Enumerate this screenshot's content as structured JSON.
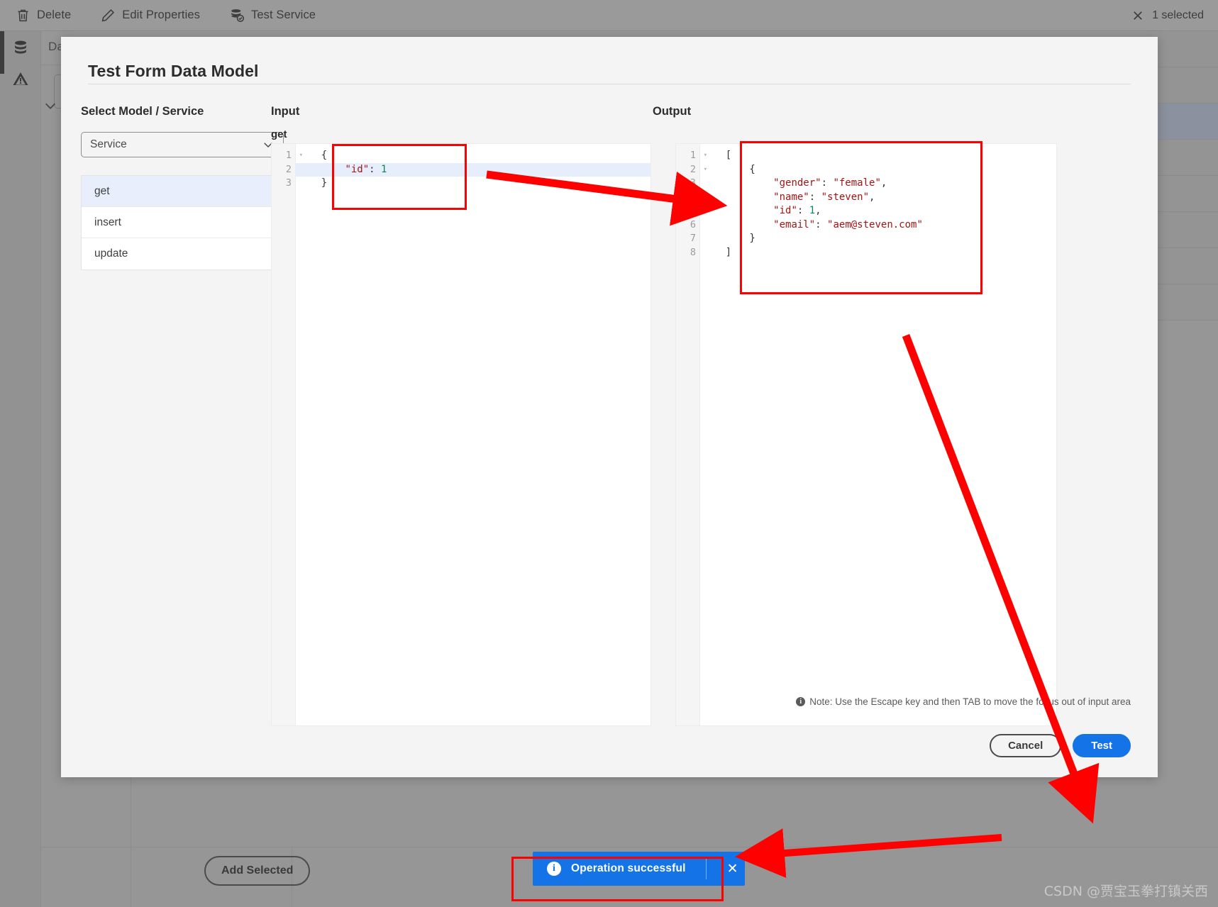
{
  "toolbar": {
    "items": [
      {
        "label": "Delete",
        "icon": "trash-icon"
      },
      {
        "label": "Edit Properties",
        "icon": "pencil-icon"
      },
      {
        "label": "Test Service",
        "icon": "database-check-icon"
      }
    ],
    "selection_label": "1 selected",
    "close_icon": "close-icon"
  },
  "background": {
    "breadcrumb": "Da",
    "add_selected_label": "Add Selected",
    "rail_icons": [
      "database-icon",
      "warning-icon"
    ]
  },
  "dialog": {
    "title": "Test Form Data Model",
    "left": {
      "label": "Select Model / Service",
      "select": {
        "value": "Service",
        "placeholder": "Service",
        "chevron": "chevron-down-icon"
      },
      "services": [
        {
          "label": "get",
          "selected": true
        },
        {
          "label": "insert",
          "selected": false
        },
        {
          "label": "update",
          "selected": false
        }
      ]
    },
    "input": {
      "label": "Input",
      "operation": "get",
      "lines": [
        {
          "num": "1",
          "fold": true,
          "text": "{",
          "highlight": false
        },
        {
          "num": "2",
          "fold": false,
          "text": "    \"id\": 1",
          "highlight": true
        },
        {
          "num": "3",
          "fold": false,
          "text": "}",
          "highlight": false
        }
      ],
      "raw": "{\n    \"id\": 1\n}"
    },
    "output": {
      "label": "Output",
      "lines": [
        {
          "num": "1",
          "fold": true,
          "text": "["
        },
        {
          "num": "2",
          "fold": true,
          "text": "    {"
        },
        {
          "num": "3",
          "fold": false,
          "text": "        \"gender\": \"female\","
        },
        {
          "num": "4",
          "fold": false,
          "text": "        \"name\": \"steven\","
        },
        {
          "num": "5",
          "fold": false,
          "text": "        \"id\": 1,"
        },
        {
          "num": "6",
          "fold": false,
          "text": "        \"email\": \"aem@steven.com\""
        },
        {
          "num": "7",
          "fold": false,
          "text": "    }"
        },
        {
          "num": "8",
          "fold": false,
          "text": "]"
        }
      ],
      "raw": "[\n    {\n        \"gender\": \"female\",\n        \"name\": \"steven\",\n        \"id\": 1,\n        \"email\": \"aem@steven.com\"\n    }\n]"
    },
    "note": "Note: Use the Escape key and then TAB to move the focus out of input area",
    "buttons": {
      "cancel": "Cancel",
      "test": "Test"
    }
  },
  "toast": {
    "message": "Operation successful",
    "icon": "info-icon",
    "close_icon": "close-icon",
    "background": "#1473e6"
  },
  "annotation": {
    "color": "#ff0000"
  },
  "watermark": "CSDN @贾宝玉拳打镇关西"
}
